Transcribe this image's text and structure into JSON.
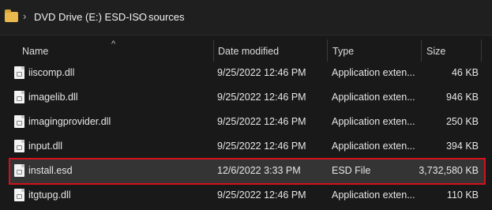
{
  "breadcrumb": {
    "items": [
      "DVD Drive (E:) ESD-ISO",
      "sources"
    ]
  },
  "columns": {
    "name": "Name",
    "date": "Date modified",
    "type": "Type",
    "size": "Size"
  },
  "files": [
    {
      "name": "iiscomp.dll",
      "date": "9/25/2022 12:46 PM",
      "type": "Application exten...",
      "size": "46 KB"
    },
    {
      "name": "imagelib.dll",
      "date": "9/25/2022 12:46 PM",
      "type": "Application exten...",
      "size": "946 KB"
    },
    {
      "name": "imagingprovider.dll",
      "date": "9/25/2022 12:46 PM",
      "type": "Application exten...",
      "size": "250 KB"
    },
    {
      "name": "input.dll",
      "date": "9/25/2022 12:46 PM",
      "type": "Application exten...",
      "size": "394 KB"
    },
    {
      "name": "install.esd",
      "date": "12/6/2022 3:33 PM",
      "type": "ESD File",
      "size": "3,732,580 KB"
    },
    {
      "name": "itgtupg.dll",
      "date": "9/25/2022 12:46 PM",
      "type": "Application exten...",
      "size": "110 KB"
    }
  ],
  "selected_index": 4,
  "colors": {
    "highlight_outline": "#d4101b",
    "selected_background": "#343434",
    "folder": "#e9b94d"
  }
}
